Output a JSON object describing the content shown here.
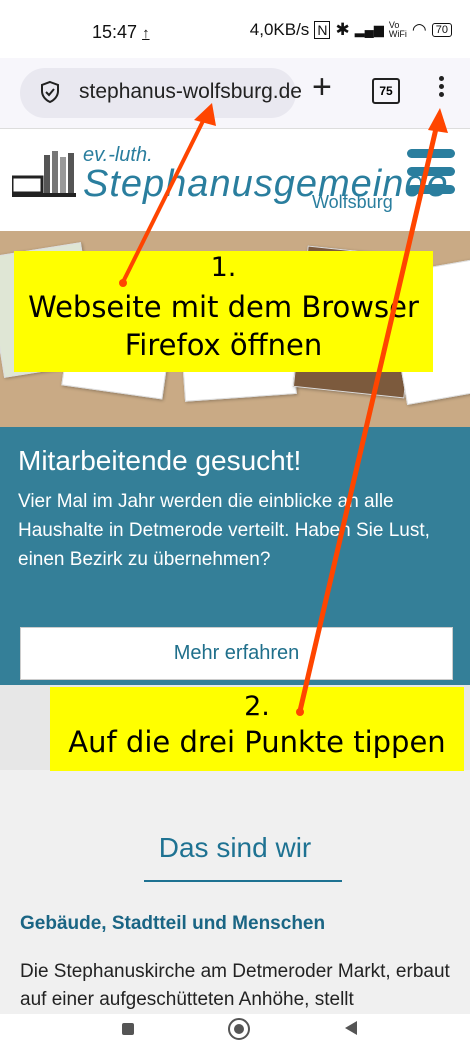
{
  "status": {
    "time": "15:47",
    "upload_icon": "upload-arrow-icon",
    "speed": "4,0KB/s",
    "battery": "70"
  },
  "browser": {
    "url": "stephanus-wolfsburg.de",
    "tab_count": "75"
  },
  "site": {
    "luth": "ev.-luth.",
    "title": "Stephanusgemeinde",
    "city": "Wolfsburg"
  },
  "annotation1": {
    "number": "1.",
    "text_line1": "Webseite mit dem Browser",
    "text_line2": "Firefox öffnen"
  },
  "banner": {
    "heading": "Mitarbeitende gesucht!",
    "text": "Vier Mal im Jahr werden die einblicke an alle Haushalte in Detmerode verteilt. Haben Sie Lust, einen Bezirk zu übernehmen?",
    "button": "Mehr erfahren"
  },
  "annotation2": {
    "number": "2.",
    "text": "Auf die drei Punkte tippen"
  },
  "section": {
    "title": "Das sind wir",
    "subheading": "Gebäude, Stadtteil und Menschen",
    "body": "Die Stephanuskirche am Detmeroder Markt, erbaut auf einer aufgeschütteten Anhöhe, stellt"
  },
  "colors": {
    "teal": "#347f98",
    "annotation_yellow": "#ffff00",
    "arrow": "#ff4500"
  }
}
